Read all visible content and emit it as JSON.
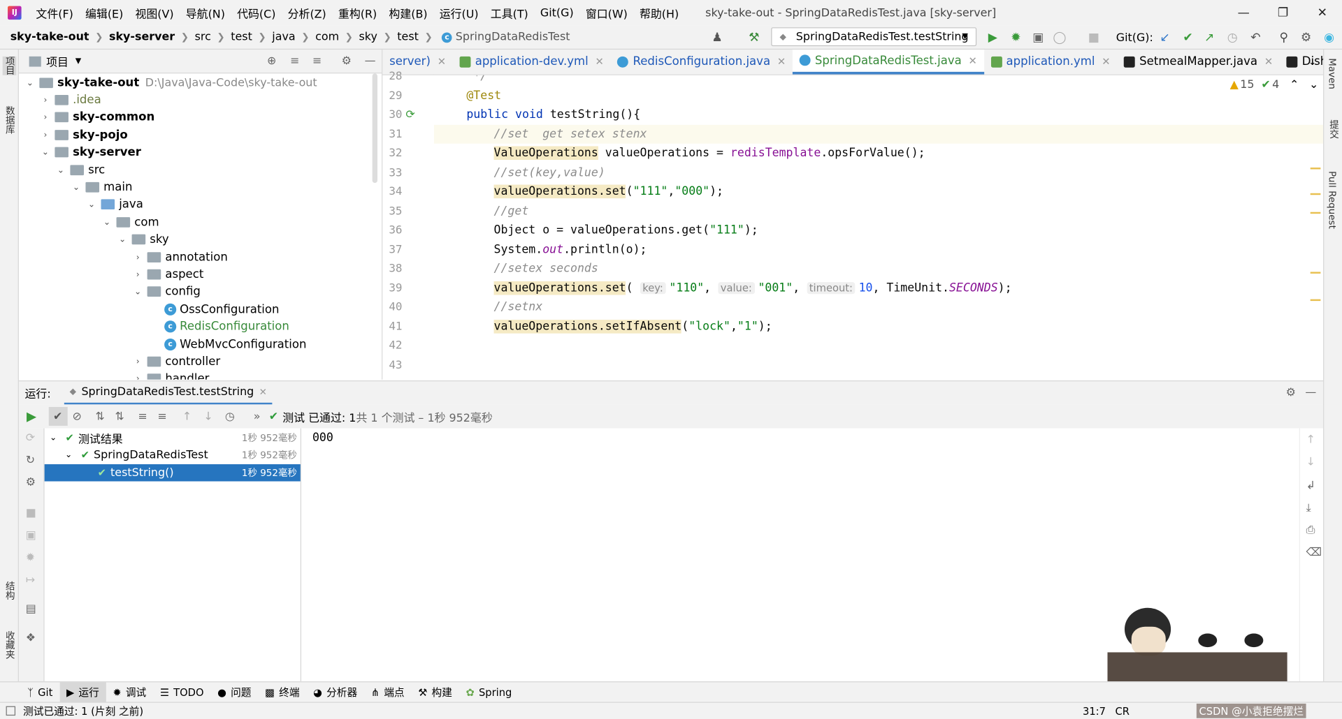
{
  "menu": [
    "文件(F)",
    "编辑(E)",
    "视图(V)",
    "导航(N)",
    "代码(C)",
    "分析(Z)",
    "重构(R)",
    "构建(B)",
    "运行(U)",
    "工具(T)",
    "Git(G)",
    "窗口(W)",
    "帮助(H)"
  ],
  "window_title": "sky-take-out - SpringDataRedisTest.java [sky-server]",
  "breadcrumb": [
    "sky-take-out",
    "sky-server",
    "src",
    "test",
    "java",
    "com",
    "sky",
    "test",
    "SpringDataRedisTest"
  ],
  "run_config": "SpringDataRedisTest.testString",
  "git_label": "Git(G):",
  "project": {
    "title": "项目",
    "root": "sky-take-out",
    "root_path": "D:\\Java\\Java-Code\\sky-take-out",
    "items": [
      ".idea",
      "sky-common",
      "sky-pojo",
      "sky-server",
      "src",
      "main",
      "java",
      "com",
      "sky",
      "annotation",
      "aspect",
      "config",
      "OssConfiguration",
      "RedisConfiguration",
      "WebMvcConfiguration",
      "controller",
      "handler"
    ]
  },
  "left_stripe": [
    "项目",
    "数据库",
    "结构",
    "收藏夹"
  ],
  "right_stripe": [
    "Maven",
    "提交",
    "Pull Request"
  ],
  "tabs": [
    "server)",
    "application-dev.yml",
    "RedisConfiguration.java",
    "SpringDataRedisTest.java",
    "application.yml",
    "SetmealMapper.java",
    "DishFlavorMapp"
  ],
  "inspections": {
    "warnings": "15",
    "ok": "4"
  },
  "code": {
    "line_numbers": [
      "28",
      "29",
      "30",
      "31",
      "32",
      "33",
      "34",
      "35",
      "36",
      "37",
      "38",
      "39",
      "40",
      "41",
      "42",
      "43"
    ],
    "l28": " */",
    "l29": "@Test",
    "l30_kw1": "public",
    "l30_kw2": "void",
    "l30_rest": " testString(){",
    "l31": "//set  get setex stenx",
    "l32_a": "ValueOperations",
    "l32_b": " valueOperations = ",
    "l32_c": "redisTemplate",
    "l32_d": ".opsForValue();",
    "l33": "//set(key,value)",
    "l34_a": "valueOperations.set",
    "l34_b": "(",
    "l34_s1": "\"111\"",
    "l34_s2": "\"000\"",
    "l34_c": ");",
    "l35": "//get",
    "l36_a": "Object o = valueOperations.get(",
    "l36_s": "\"111\"",
    "l36_b": ");",
    "l37_a": "System.",
    "l37_b": "out",
    "l37_c": ".println(o);",
    "l38": "//setex seconds",
    "l39_a": "valueOperations.set",
    "l39_h1": "key:",
    "l39_s1": "\"110\"",
    "l39_h2": "value:",
    "l39_s2": "\"001\"",
    "l39_h3": "timeout:",
    "l39_n": "10",
    "l39_c": ", TimeUnit.",
    "l39_d": "SECONDS",
    "l39_e": ");",
    "l40": "//setnx",
    "l41_a": "valueOperations.setIfAbsent",
    "l41_s1": "\"lock\"",
    "l41_s2": "\"1\"",
    "l41_b": ");"
  },
  "run": {
    "label": "运行:",
    "tab": "SpringDataRedisTest.testString",
    "status_prefix": "测试 已通过:",
    "status_count": "1",
    "status_rest": "共 1 个测试 – 1秒 952毫秒",
    "tree": [
      {
        "label": "测试结果",
        "time": "1秒 952毫秒"
      },
      {
        "label": "SpringDataRedisTest",
        "time": "1秒 952毫秒"
      },
      {
        "label": "testString()",
        "time": "1秒 952毫秒"
      }
    ],
    "console_output": "000"
  },
  "bottom_tabs": [
    "Git",
    "运行",
    "调试",
    "TODO",
    "问题",
    "终端",
    "分析器",
    "端点",
    "构建",
    "Spring"
  ],
  "status": {
    "message": "测试已通过: 1 (片刻 之前)",
    "position": "31:7",
    "crlf": "CR",
    "watermark": "CSDN @小袁拒绝摆烂"
  }
}
